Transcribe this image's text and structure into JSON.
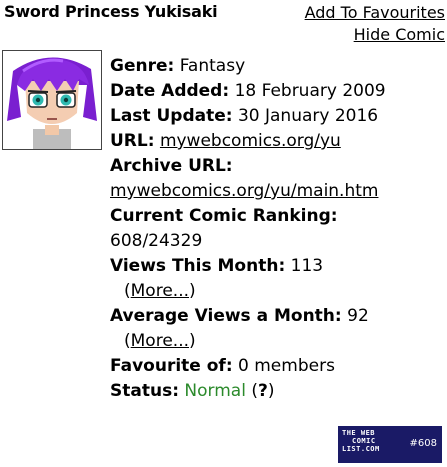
{
  "comic": {
    "title": "Sword Princess Yukisaki"
  },
  "actions": {
    "add_favourites": "Add To Favourites",
    "hide_comic": "Hide Comic"
  },
  "fields": {
    "genre_label": "Genre:",
    "genre_value": "Fantasy",
    "date_added_label": "Date Added:",
    "date_added_value": "18 February 2009",
    "last_update_label": "Last Update:",
    "last_update_value": "30 January 2016",
    "url_label": "URL:",
    "url_value": "mywebcomics.org/yu",
    "archive_label": "Archive URL:",
    "archive_value": "mywebcomics.org/yu/main.htm",
    "ranking_label": "Current Comic Ranking:",
    "ranking_value": "608/24329",
    "views_month_label": "Views This Month:",
    "views_month_value": "113",
    "avg_views_label": "Average Views a Month:",
    "avg_views_value": "92",
    "more_link": "More...",
    "favourite_label": "Favourite of:",
    "favourite_value": "0 members",
    "status_label": "Status:",
    "status_value": "Normal",
    "status_help": "?"
  },
  "badge": {
    "line1": "THE WEB",
    "line2": "COMIC",
    "line3": "LIST.COM",
    "rank": "#608"
  },
  "colors": {
    "status_normal": "#2b8a2b",
    "help_mark": "#d00000",
    "badge_bg": "#1a1a66"
  }
}
